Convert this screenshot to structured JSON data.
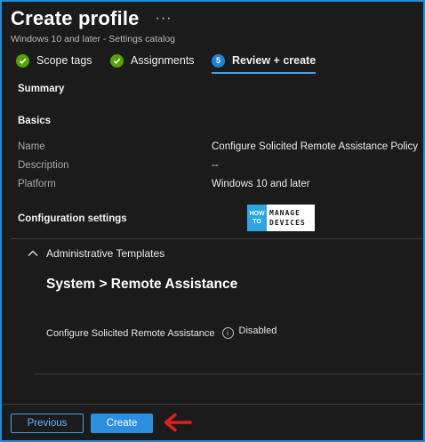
{
  "header": {
    "title": "Create profile",
    "more_label": "···",
    "subtitle": "Windows 10 and later - Settings catalog"
  },
  "tabs": [
    {
      "label": "Scope tags",
      "state": "complete"
    },
    {
      "label": "Assignments",
      "state": "complete"
    },
    {
      "label": "Review + create",
      "state": "active",
      "step": "5"
    }
  ],
  "summary": {
    "heading": "Summary",
    "basics_heading": "Basics",
    "rows": [
      {
        "label": "Name",
        "value": "Configure Solicited Remote Assistance Policy"
      },
      {
        "label": "Description",
        "value": "--"
      },
      {
        "label": "Platform",
        "value": "Windows 10 and later"
      }
    ],
    "config_heading": "Configuration settings"
  },
  "logo": {
    "how": "HOW",
    "to": "TO",
    "line1": "MANAGE",
    "line2": "DEVICES"
  },
  "accordion": {
    "label": "Administrative Templates",
    "path": "System > Remote Assistance",
    "setting_label": "Configure Solicited Remote Assistance",
    "info_icon": "i",
    "setting_value": "Disabled"
  },
  "partial_text": "_",
  "footer": {
    "previous_label": "Previous",
    "create_label": "Create"
  },
  "colors": {
    "accent": "#2b8fe0",
    "check": "#57a300",
    "arrow": "#e0201c"
  }
}
